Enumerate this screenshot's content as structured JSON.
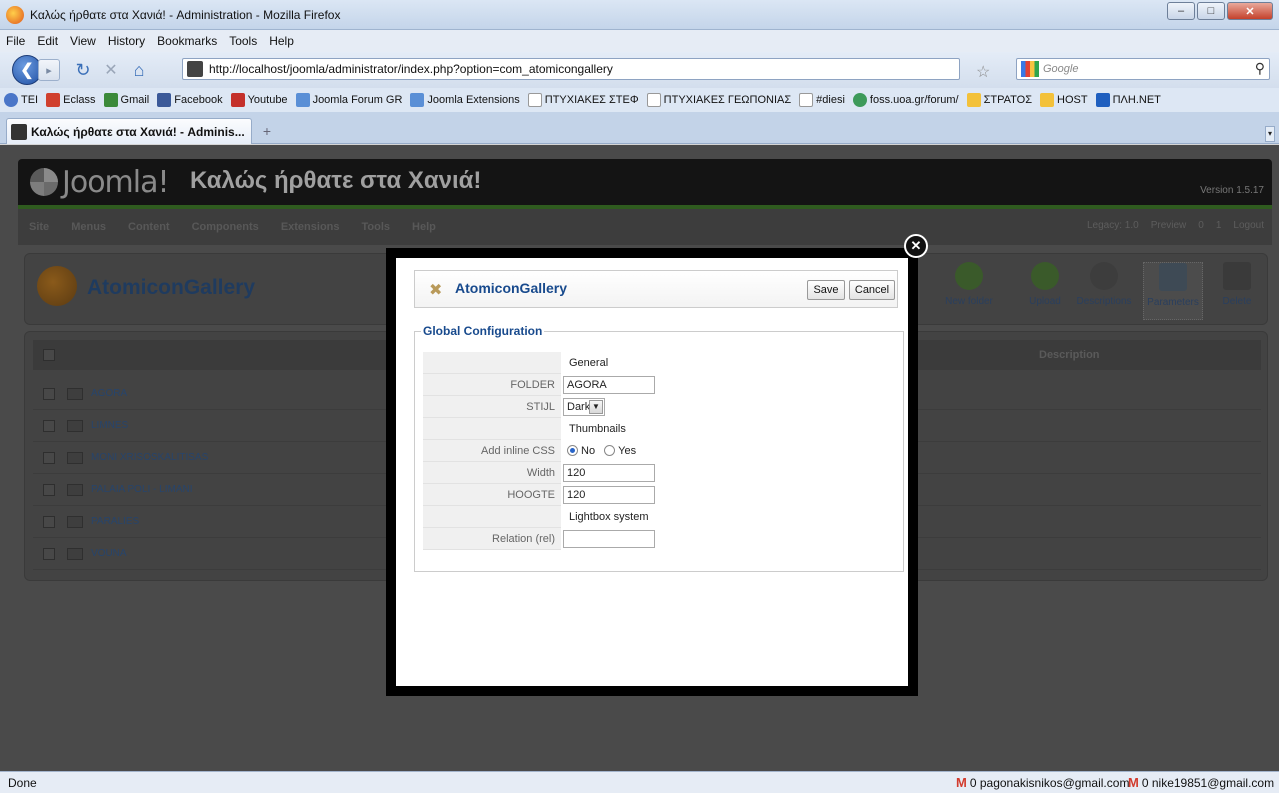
{
  "browser": {
    "window_title": "Καλώς ήρθατε στα Χανιά! - Administration - Mozilla Firefox",
    "menu": [
      "File",
      "Edit",
      "View",
      "History",
      "Bookmarks",
      "Tools",
      "Help"
    ],
    "url": "http://localhost/joomla/administrator/index.php?option=com_atomicongallery",
    "search_placeholder": "Google",
    "bookmarks": [
      "TEI",
      "Eclass",
      "Gmail",
      "Facebook",
      "Youtube",
      "Joomla Forum GR",
      "Joomla Extensions",
      "ΠΤΥΧΙΑΚΕΣ ΣΤΕΦ",
      "ΠΤΥΧΙΑΚΕΣ ΓΕΩΠΟΝΙΑΣ",
      "#diesi",
      "foss.uoa.gr/forum/",
      "ΣΤΡΑΤΟΣ",
      "HOST",
      "ΠΛΗ.NET"
    ],
    "tab_title": "Καλώς ήρθατε στα Χανιά! - Adminis...",
    "status_text": "Done",
    "gmail1": "0 pagonakisnikos@gmail.com",
    "gmail2": "0 nike19851@gmail.com"
  },
  "admin": {
    "logo_text": "Joomla!",
    "site_name": "Καλώς ήρθατε στα Χανιά!",
    "version": "Version 1.5.17",
    "menu": [
      "Site",
      "Menus",
      "Content",
      "Components",
      "Extensions",
      "Tools",
      "Help"
    ],
    "status": {
      "legacy": "Legacy: 1.0",
      "preview": "Preview",
      "messages": "0",
      "users": "1",
      "logout": "Logout"
    },
    "component_title": "AtomiconGallery",
    "toolbar": [
      "New folder",
      "Upload",
      "Descriptions",
      "Parameters",
      "Delete"
    ],
    "description_header": "Description",
    "folders": [
      "AGORA",
      "LIMNES",
      "MONI XRISOSKALITISAS",
      "PALAIA POLI - LIMANI",
      "PARALIES",
      "VOUNA"
    ]
  },
  "modal": {
    "title": "AtomiconGallery",
    "save_label": "Save",
    "cancel_label": "Cancel",
    "legend": "Global Configuration",
    "sections": {
      "general": "General",
      "thumbnails": "Thumbnails",
      "lightbox": "Lightbox system"
    },
    "fields": {
      "folder_label": "FOLDER",
      "folder_value": "AGORA",
      "style_label": "STIJL",
      "style_value": "Dark",
      "inline_css_label": "Add inline CSS",
      "no_label": "No",
      "yes_label": "Yes",
      "inline_css_selected": "No",
      "width_label": "Width",
      "width_value": "120",
      "height_label": "HOOGTE",
      "height_value": "120",
      "relation_label": "Relation (rel)",
      "relation_value": ""
    }
  }
}
